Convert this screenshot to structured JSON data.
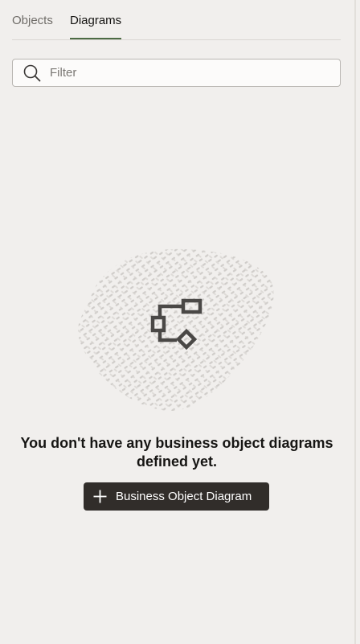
{
  "tabs": [
    {
      "label": "Objects",
      "selected": false
    },
    {
      "label": "Diagrams",
      "selected": true
    }
  ],
  "filter": {
    "placeholder": "Filter",
    "value": "",
    "icon": "search-icon"
  },
  "empty_state": {
    "illustration_icon": "diagram-icon",
    "message_line1": "You don't have any business object diagrams",
    "message_line2": "defined yet."
  },
  "create_button": {
    "icon": "plus-icon",
    "label": "Business Object Diagram"
  },
  "colors": {
    "background": "#f1efed",
    "tab_indicator": "#4c6b44",
    "button_background": "#312d2a",
    "button_text": "#ffffff",
    "text_primary": "#161513",
    "text_secondary": "#6f6c68"
  }
}
